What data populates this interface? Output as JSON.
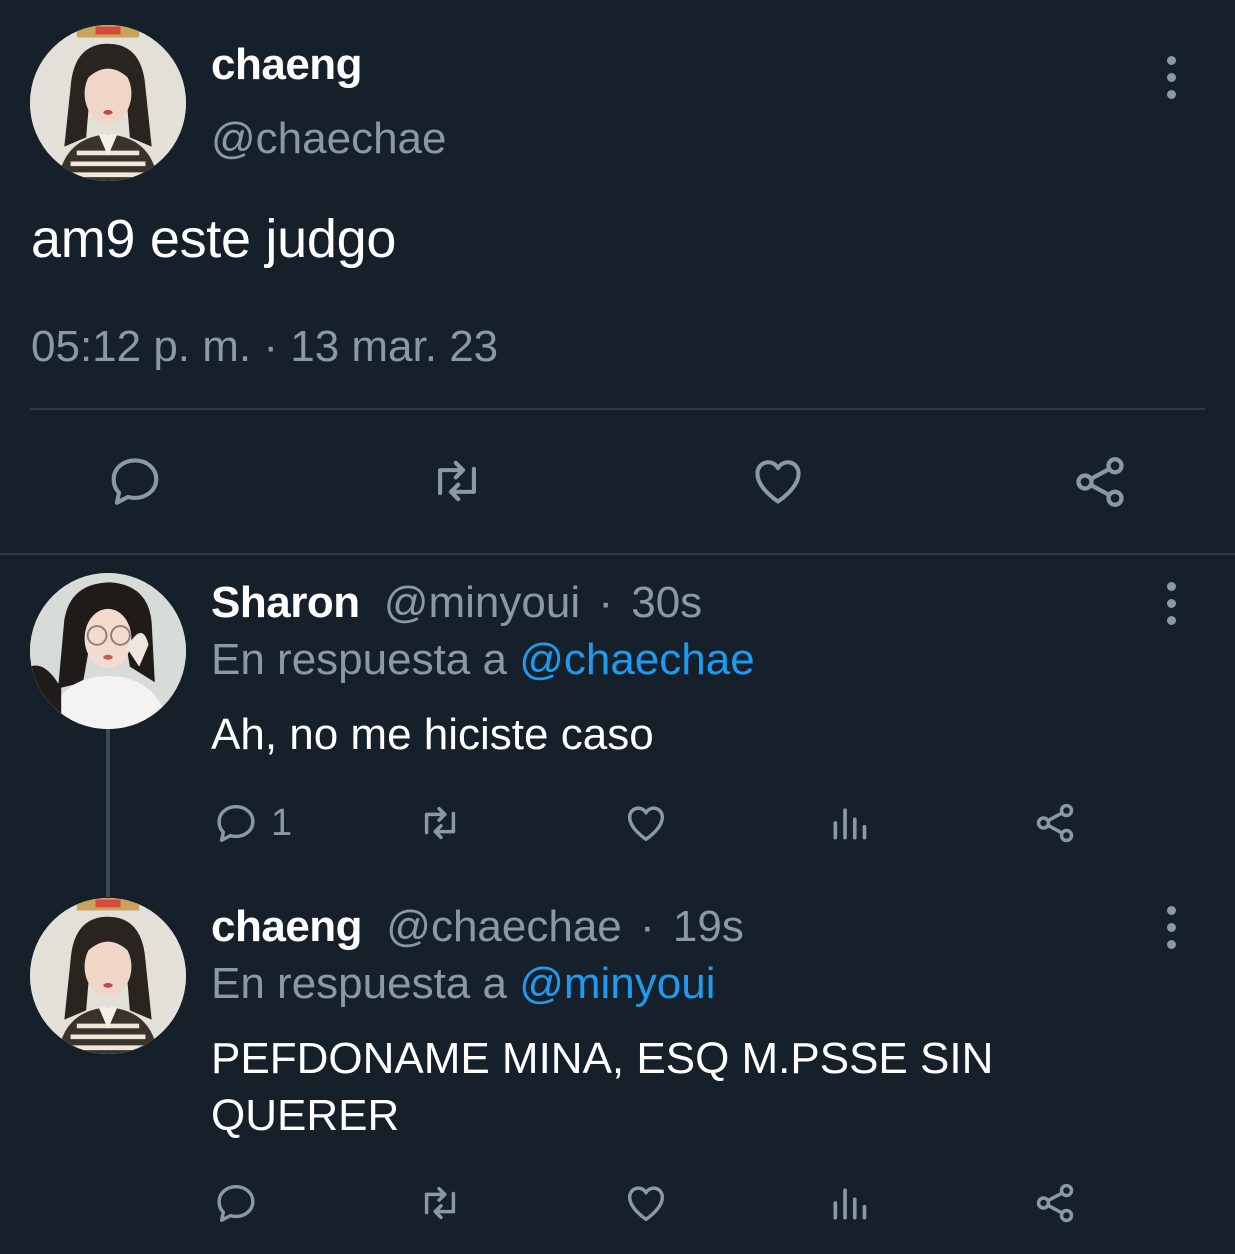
{
  "main_tweet": {
    "name": "chaeng",
    "handle": "@chaechae",
    "text": "am9 este judgo",
    "timestamp": "05:12 p. m. · 13 mar. 23",
    "icons": [
      "reply-icon",
      "retweet-icon",
      "like-icon",
      "share-icon"
    ]
  },
  "replies": [
    {
      "name": "Sharon",
      "handle": "@minyoui",
      "separator": "·",
      "time": "30s",
      "reply_prefix": "En respuesta a",
      "reply_to": "@chaechae",
      "text": "Ah, no me hiciste caso",
      "reply_count": "1"
    },
    {
      "name": "chaeng",
      "handle": "@chaechae",
      "separator": "·",
      "time": "19s",
      "reply_prefix": "En respuesta a",
      "reply_to": "@minyoui",
      "text": "PEFDONAME MINA, ESQ M.PSSE SIN QUERER",
      "reply_count": ""
    }
  ],
  "colors": {
    "background": "#15202b",
    "secondary_text": "#8b98a5",
    "link": "#1d9bf0",
    "divider": "#2f3b47"
  }
}
